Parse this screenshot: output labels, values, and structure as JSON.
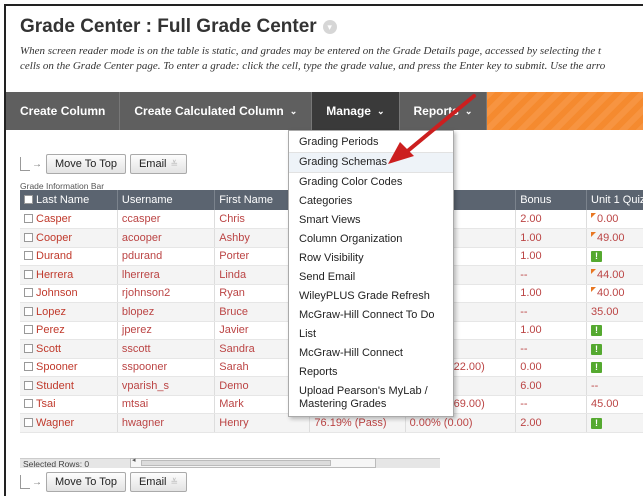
{
  "page": {
    "title": "Grade Center : Full Grade Center",
    "help_line1": "When screen reader mode is on the table is static, and grades may be entered on the Grade Details page, accessed by selecting the t",
    "help_line2": "cells on the Grade Center page. To enter a grade: click the cell, type the grade value, and press the Enter key to submit. Use the arro"
  },
  "actionbar": {
    "create_column": "Create Column",
    "create_calculated": "Create Calculated Column",
    "manage": "Manage",
    "reports": "Reports"
  },
  "manage_menu": [
    "Grading Periods",
    "Grading Schemas",
    "Grading Color Codes",
    "Categories",
    "Smart Views",
    "Column Organization",
    "Row Visibility",
    "Send Email",
    "WileyPLUS Grade Refresh",
    "McGraw-Hill Connect To Do List",
    "McGraw-Hill Connect Reports",
    "Upload Pearson's MyLab / Mastering Grades"
  ],
  "toolbar": {
    "move_to_top": "Move To Top",
    "email": "Email"
  },
  "info_bar_label": "Grade Information Bar",
  "columns": [
    "Last Name",
    "Username",
    "First Name",
    "",
    "",
    "Bonus",
    "Unit 1 Quiz"
  ],
  "rows": [
    {
      "last": "Casper",
      "user": "ccasper",
      "first": "Chris",
      "c4": "",
      "c5": ")",
      "bonus": "2.00",
      "quiz": "0.00",
      "flag": true,
      "green": false
    },
    {
      "last": "Cooper",
      "user": "acooper",
      "first": "Ashby",
      "c4": "",
      "c5": "))",
      "bonus": "1.00",
      "quiz": "49.00",
      "flag": true,
      "green": false
    },
    {
      "last": "Durand",
      "user": "pdurand",
      "first": "Porter",
      "c4": "",
      "c5": "))",
      "bonus": "1.00",
      "quiz": "",
      "flag": false,
      "green": true
    },
    {
      "last": "Herrera",
      "user": "lherrera",
      "first": "Linda",
      "c4": "",
      "c5": "))",
      "bonus": "--",
      "quiz": "44.00",
      "flag": true,
      "green": false
    },
    {
      "last": "Johnson",
      "user": "rjohnson2",
      "first": "Ryan",
      "c4": "",
      "c5": "))",
      "bonus": "1.00",
      "quiz": "40.00",
      "flag": true,
      "green": false
    },
    {
      "last": "Lopez",
      "user": "blopez",
      "first": "Bruce",
      "c4": "",
      "c5": "))",
      "bonus": "--",
      "quiz": "35.00",
      "flag": false,
      "green": false
    },
    {
      "last": "Perez",
      "user": "jperez",
      "first": "Javier",
      "c4": "",
      "c5": "))",
      "bonus": "1.00",
      "quiz": "",
      "flag": false,
      "green": true
    },
    {
      "last": "Scott",
      "user": "sscott",
      "first": "Sandra",
      "c4": "",
      "c5": "))",
      "bonus": "--",
      "quiz": "",
      "flag": false,
      "green": true
    },
    {
      "last": "Spooner",
      "user": "sspooner",
      "first": "Sarah",
      "c4": "98.75% (Pass)",
      "c5": "73.33% (22.00)",
      "bonus": "0.00",
      "quiz": "",
      "flag": false,
      "green": true
    },
    {
      "last": "Student",
      "user": "vparish_s",
      "first": "Demo",
      "c4": "43.47% (Fail)",
      "c5": "--",
      "bonus": "6.00",
      "quiz": "--",
      "flag": false,
      "green": false
    },
    {
      "last": "Tsai",
      "user": "mtsai",
      "first": "Mark",
      "c4": "68.46% (Pass)",
      "c5": "86.25% (69.00)",
      "bonus": "--",
      "quiz": "45.00",
      "flag": false,
      "green": false
    },
    {
      "last": "Wagner",
      "user": "hwagner",
      "first": "Henry",
      "c4": "76.19% (Pass)",
      "c5": "0.00% (0.00)",
      "bonus": "2.00",
      "quiz": "",
      "flag": false,
      "green": true
    }
  ],
  "status": {
    "selected_rows": "Selected Rows: 0",
    "scroll_mark": "III"
  },
  "colors": {
    "accent": "#f58a2f",
    "header": "#5b6470",
    "name_link": "#c0392b",
    "arrow": "#cc1f1f"
  }
}
